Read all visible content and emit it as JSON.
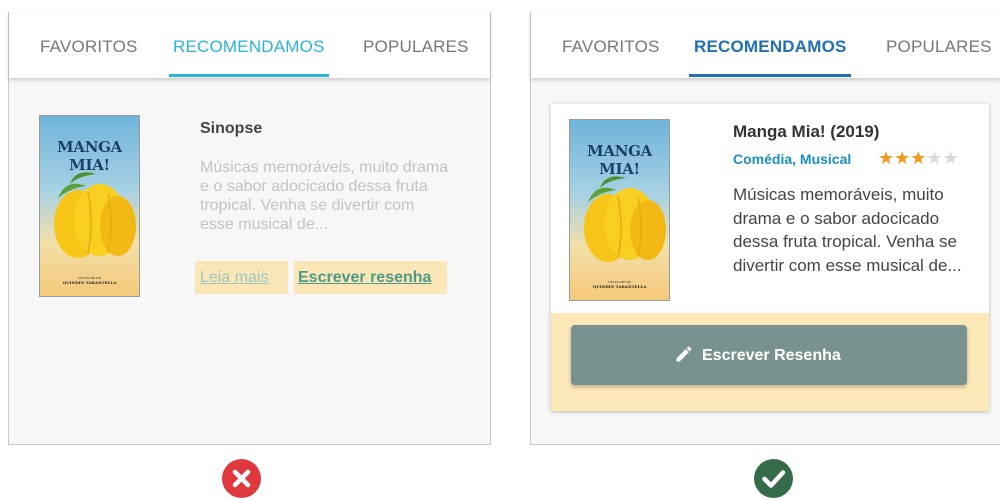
{
  "colors": {
    "bad_tab_accent": "#2ab4d8",
    "good_tab_accent": "#1f6fb5",
    "button": "#78938f",
    "footer_highlight": "#fde9b8",
    "star_on": "#f39b18",
    "star_off": "#d9d9d9",
    "error": "#e0383f",
    "success": "#356b49"
  },
  "panel_bad": {
    "tabs": [
      {
        "label": "FAVORITOS",
        "active": false
      },
      {
        "label": "RECOMENDAMOS",
        "active": true
      },
      {
        "label": "POPULARES",
        "active": false
      }
    ],
    "poster": {
      "title": "MANGA MIA!",
      "credit_sub": "UM FILME DE",
      "credit": "QUINDIN TARANTELLA"
    },
    "heading": "Sinopse",
    "synopsis": "Músicas memoráveis, muito drama e o sabor adocicado dessa fruta tropical. Venha se divertir com esse musical de...",
    "read_more": "Leia mais",
    "write_review": "Escrever resenha",
    "result_icon": "error-x-icon"
  },
  "panel_good": {
    "tabs": [
      {
        "label": "FAVORITOS",
        "active": false
      },
      {
        "label": "RECOMENDAMOS",
        "active": true
      },
      {
        "label": "POPULARES",
        "active": false
      }
    ],
    "poster": {
      "title": "MANGA MIA!",
      "credit_sub": "UM FILME DE",
      "credit": "QUINDIN TARANTELLA"
    },
    "title": "Manga Mia! (2019)",
    "genre": "Comédia, Musical",
    "rating": 3,
    "rating_max": 5,
    "synopsis": "Músicas memoráveis, muito drama e o sabor adocicado dessa fruta tropical. Venha se divertir com esse musical de...",
    "button_label": "Escrever Resenha",
    "button_icon": "pencil-icon",
    "result_icon": "success-check-icon"
  }
}
